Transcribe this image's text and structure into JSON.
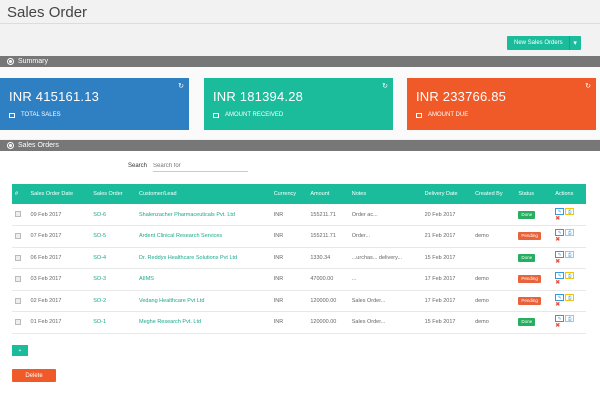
{
  "header": {
    "title": "Sales Order"
  },
  "toolbar": {
    "new_order_label": "New Sales Orders"
  },
  "summary": {
    "title": "Summary",
    "cards": [
      {
        "amount": "INR 415161.13",
        "label": "TOTAL SALES",
        "color": "#2f7fc3"
      },
      {
        "amount": "INR 181394.28",
        "label": "AMOUNT RECEIVED",
        "color": "#1abc9c"
      },
      {
        "amount": "INR 233766.85",
        "label": "AMOUNT DUE",
        "color": "#f05a28"
      }
    ]
  },
  "orders": {
    "title": "Sales Orders",
    "search_label": "Search",
    "search_placeholder": "Search for",
    "columns": [
      "#",
      "Sales Order Date",
      "Sales Order",
      "Customer/Lead",
      "Currency",
      "Amount",
      "Notes",
      "Delivery Date",
      "Created By",
      "Status",
      "Actions"
    ],
    "rows": [
      {
        "date": "09 Feb 2017",
        "order": "SO-6",
        "customer": "Shalenzacher Pharmaceuticals Pvt. Ltd",
        "currency": "INR",
        "amount": "155211.71",
        "notes": "Order ac...",
        "delivery": "20 Feb 2017",
        "created_by": "",
        "status": "Done"
      },
      {
        "date": "07 Feb 2017",
        "order": "SO-5",
        "customer": "Ardent Clinical Research Services",
        "currency": "INR",
        "amount": "155211.71",
        "notes": "Order...",
        "delivery": "21 Feb 2017",
        "created_by": "demo",
        "status": "Pending"
      },
      {
        "date": "06 Feb 2017",
        "order": "SO-4",
        "customer": "Dr. Reddys Healthcare Solutions Pvt Ltd",
        "currency": "INR",
        "amount": "1330.34",
        "notes": "...urchas... delivery...",
        "delivery": "15 Feb 2017",
        "created_by": "",
        "status": "Done"
      },
      {
        "date": "03 Feb 2017",
        "order": "SO-3",
        "customer": "AIIMS",
        "currency": "INR",
        "amount": "47000.00",
        "notes": "...",
        "delivery": "17 Feb 2017",
        "created_by": "demo",
        "status": "Pending"
      },
      {
        "date": "02 Feb 2017",
        "order": "SO-2",
        "customer": "Vedang Healthcare Pvt Ltd",
        "currency": "INR",
        "amount": "120000.00",
        "notes": "Sales Order...",
        "delivery": "17 Feb 2017",
        "created_by": "demo",
        "status": "Pending"
      },
      {
        "date": "01 Feb 2017",
        "order": "SO-1",
        "customer": "Meghe Research Pvt. Ltd",
        "currency": "INR",
        "amount": "120000.00",
        "notes": "Sales Order...",
        "delivery": "15 Feb 2017",
        "created_by": "demo",
        "status": "Done"
      }
    ]
  },
  "footer": {
    "small_button_label": "+",
    "delete_label": "Delete"
  }
}
